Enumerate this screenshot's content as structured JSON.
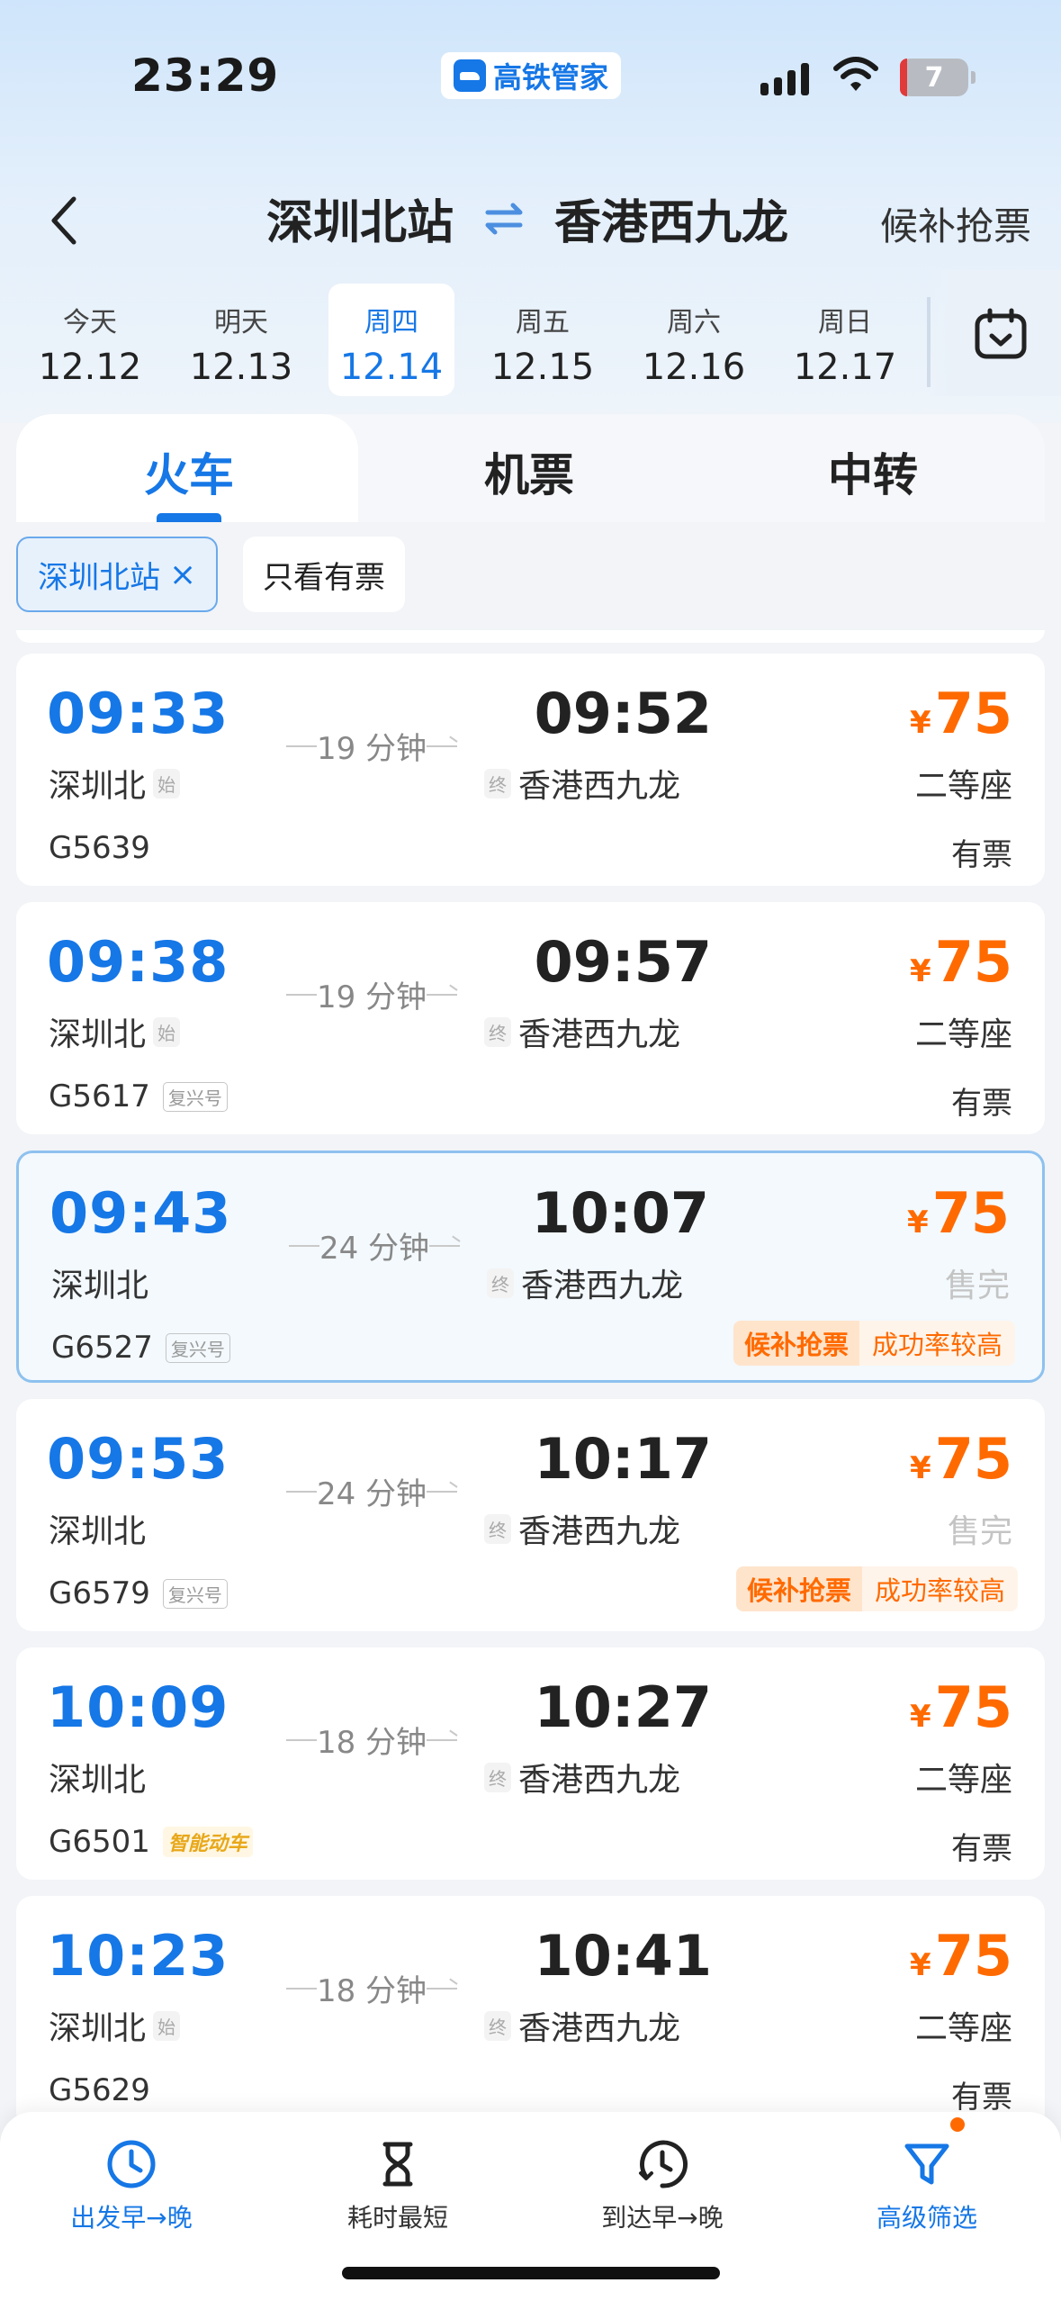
{
  "status_bar": {
    "time": "23:29",
    "app_name": "高铁管家",
    "battery": "7"
  },
  "header": {
    "from": "深圳北站",
    "to": "香港西九龙",
    "waitlist": "候补抢票"
  },
  "dates": [
    {
      "weekday": "今天",
      "date": "12.12",
      "active": false
    },
    {
      "weekday": "明天",
      "date": "12.13",
      "active": false
    },
    {
      "weekday": "周四",
      "date": "12.14",
      "active": true
    },
    {
      "weekday": "周五",
      "date": "12.15",
      "active": false
    },
    {
      "weekday": "周六",
      "date": "12.16",
      "active": false
    },
    {
      "weekday": "周日",
      "date": "12.17",
      "active": false
    }
  ],
  "tabs": [
    {
      "label": "火车",
      "active": true
    },
    {
      "label": "机票",
      "active": false
    },
    {
      "label": "中转",
      "active": false
    }
  ],
  "filters": {
    "station": "深圳北站",
    "station_clear": "×",
    "only_available": "只看有票"
  },
  "trains": [
    {
      "dep": "09:33",
      "dep_station": "深圳北",
      "dep_tag": "始",
      "duration": "19 分钟",
      "arr": "09:52",
      "arr_tag": "终",
      "arr_station": "香港西九龙",
      "currency": "¥",
      "price": "75",
      "seat": "二等座",
      "sold_out": false,
      "train_no": "G5639",
      "badge": "",
      "availability": "有票",
      "waitlist": "",
      "waitlist_note": ""
    },
    {
      "dep": "09:38",
      "dep_station": "深圳北",
      "dep_tag": "始",
      "duration": "19 分钟",
      "arr": "09:57",
      "arr_tag": "终",
      "arr_station": "香港西九龙",
      "currency": "¥",
      "price": "75",
      "seat": "二等座",
      "sold_out": false,
      "train_no": "G5617",
      "badge": "复兴号",
      "availability": "有票",
      "waitlist": "",
      "waitlist_note": ""
    },
    {
      "dep": "09:43",
      "dep_station": "深圳北",
      "dep_tag": "",
      "duration": "24 分钟",
      "arr": "10:07",
      "arr_tag": "终",
      "arr_station": "香港西九龙",
      "currency": "¥",
      "price": "75",
      "seat": "售完",
      "sold_out": true,
      "train_no": "G6527",
      "badge": "复兴号",
      "availability": "",
      "waitlist": "候补抢票",
      "waitlist_note": "成功率较高"
    },
    {
      "dep": "09:53",
      "dep_station": "深圳北",
      "dep_tag": "",
      "duration": "24 分钟",
      "arr": "10:17",
      "arr_tag": "终",
      "arr_station": "香港西九龙",
      "currency": "¥",
      "price": "75",
      "seat": "售完",
      "sold_out": true,
      "train_no": "G6579",
      "badge": "复兴号",
      "availability": "",
      "waitlist": "候补抢票",
      "waitlist_note": "成功率较高"
    },
    {
      "dep": "10:09",
      "dep_station": "深圳北",
      "dep_tag": "",
      "duration": "18 分钟",
      "arr": "10:27",
      "arr_tag": "终",
      "arr_station": "香港西九龙",
      "currency": "¥",
      "price": "75",
      "seat": "二等座",
      "sold_out": false,
      "train_no": "G6501",
      "badge": "智能动车",
      "availability": "有票",
      "waitlist": "",
      "waitlist_note": ""
    },
    {
      "dep": "10:23",
      "dep_station": "深圳北",
      "dep_tag": "始",
      "duration": "18 分钟",
      "arr": "10:41",
      "arr_tag": "终",
      "arr_station": "香港西九龙",
      "currency": "¥",
      "price": "75",
      "seat": "二等座",
      "sold_out": false,
      "train_no": "G5629",
      "badge": "",
      "availability": "有票",
      "waitlist": "",
      "waitlist_note": ""
    }
  ],
  "bottom_bar": [
    {
      "label": "出发早→晚",
      "icon": "clock-icon",
      "active": true
    },
    {
      "label": "耗时最短",
      "icon": "hourglass-icon",
      "active": false
    },
    {
      "label": "到达早→晚",
      "icon": "clock-arrival-icon",
      "active": false
    },
    {
      "label": "高级筛选",
      "icon": "filter-icon",
      "active": true
    }
  ],
  "colors": {
    "accent": "#1677e6",
    "price": "#ff6a00"
  }
}
